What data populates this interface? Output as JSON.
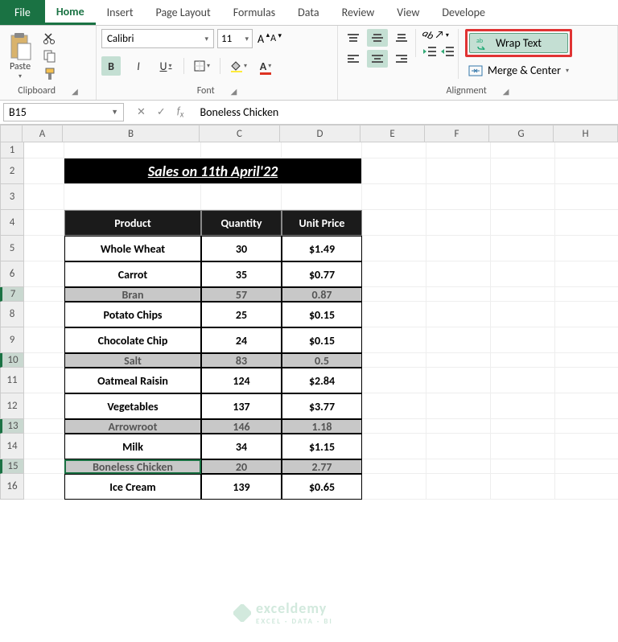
{
  "tabs": {
    "file": "File",
    "items": [
      "Home",
      "Insert",
      "Page Layout",
      "Formulas",
      "Data",
      "Review",
      "View",
      "Develope"
    ],
    "active": 0
  },
  "ribbon": {
    "clipboard": {
      "paste": "Paste",
      "label": "Clipboard"
    },
    "font": {
      "name": "Calibri",
      "size": "11",
      "bold": "B",
      "italic": "I",
      "underline": "U",
      "label": "Font"
    },
    "alignment": {
      "wrap": "Wrap Text",
      "merge": "Merge & Center",
      "label": "Alignment"
    }
  },
  "namebox": "B15",
  "formula": "Boneless Chicken",
  "columns": [
    "A",
    "B",
    "C",
    "D",
    "E",
    "F",
    "G",
    "H"
  ],
  "rows": [
    {
      "n": "1",
      "h": "h-r1",
      "cells": [
        "",
        "",
        "",
        ""
      ]
    },
    {
      "n": "2",
      "h": "h-norm",
      "title": "Sales on 11th April'22"
    },
    {
      "n": "3",
      "h": "h-norm",
      "cells": [
        "",
        "",
        "",
        ""
      ]
    },
    {
      "n": "4",
      "h": "h-norm",
      "head": [
        "Product",
        "Quantity",
        "Unit Price"
      ]
    },
    {
      "n": "5",
      "h": "h-norm",
      "data": [
        "Whole Wheat",
        "30",
        "$1.49"
      ]
    },
    {
      "n": "6",
      "h": "h-norm",
      "data": [
        "Carrot",
        "35",
        "$0.77"
      ]
    },
    {
      "n": "7",
      "h": "h-small",
      "gray": [
        "Bran",
        "57",
        "0.87"
      ],
      "sel": true
    },
    {
      "n": "8",
      "h": "h-norm",
      "data": [
        "Potato Chips",
        "25",
        "$0.15"
      ]
    },
    {
      "n": "9",
      "h": "h-norm",
      "data": [
        "Chocolate Chip",
        "24",
        "$0.15"
      ]
    },
    {
      "n": "10",
      "h": "h-small",
      "gray": [
        "Salt",
        "83",
        "0.5"
      ],
      "sel": true
    },
    {
      "n": "11",
      "h": "h-norm",
      "data": [
        "Oatmeal Raisin",
        "124",
        "$2.84"
      ]
    },
    {
      "n": "12",
      "h": "h-norm",
      "data": [
        "Vegetables",
        "137",
        "$3.77"
      ]
    },
    {
      "n": "13",
      "h": "h-small",
      "gray": [
        "Arrowroot",
        "146",
        "1.18"
      ],
      "sel": true
    },
    {
      "n": "14",
      "h": "h-norm",
      "data": [
        "Milk",
        "34",
        "$1.15"
      ]
    },
    {
      "n": "15",
      "h": "h-small",
      "gray": [
        "Boneless Chicken",
        "20",
        "2.77"
      ],
      "sel": true,
      "active": true
    },
    {
      "n": "16",
      "h": "h-norm",
      "data": [
        "Ice Cream",
        "139",
        "$0.65"
      ]
    }
  ],
  "watermark": {
    "main": "exceldemy",
    "sub": "EXCEL · DATA · BI"
  }
}
